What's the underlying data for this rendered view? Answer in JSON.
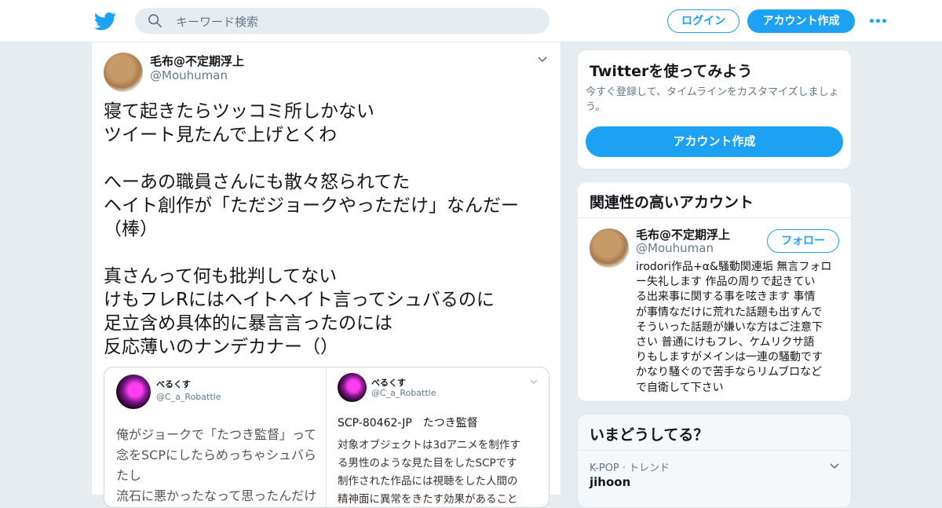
{
  "header": {
    "search_placeholder": "キーワード検索",
    "login_label": "ログイン",
    "signup_label": "アカウント作成"
  },
  "tweet": {
    "name": "毛布@不定期浮上",
    "handle": "@Mouhuman",
    "text": "寝て起きたらツッコミ所しかない\nツイート見たんで上げとくわ\n\nへーあの職員さんにも散々怒られてた\nヘイト創作が「ただジョークやっただけ」なんだー\n（棒）\n\n真さんって何も批判してない\nけもフレRにはヘイトヘイト言ってシュバるのに\n足立含め具体的に暴言言ったのには\n反応薄いのナンデカナー（）",
    "quote": {
      "left": {
        "name": "べるくす",
        "handle": "@C_a_Robattle",
        "text": "俺がジョークで「たつき監督」って\n念をSCPにしたらめっちゃシュバら\nたし\n流石に悪かったなって思ったんだけ"
      },
      "right": {
        "name": "べるくす",
        "handle": "@C_a_Robattle",
        "title": "SCP-80462-JP　たつき監督",
        "body": "対象オブジェクトは3dアニメを制作す\nる男性のような見た目をしたSCPです\n制作された作品には視聴をした人間の\n精神面に異常をきたす効果があること"
      }
    }
  },
  "signup_card": {
    "title": "Twitterを使ってみよう",
    "subtitle": "今すぐ登録して、タイムラインをカスタマイズしましょう。",
    "button_label": "アカウント作成"
  },
  "related_card": {
    "title": "関連性の高いアカウント",
    "name": "毛布@不定期浮上",
    "handle": "@Mouhuman",
    "follow_label": "フォロー",
    "bio": "irodori作品+α&騒動関連垢 無言フォロ\nー失礼します 作品の周りで起きてい\nる出来事に関する事を呟きます 事情\nが事情なだけに荒れた話題も出すんで\nそういった話題が嫌いな方はご注意下\nさい 普通にけもフレ、ケムリクサ語\nりもしますがメインは一連の騒動です\nかなり騒ぐので苦手ならリムブロなど\nで自衛して下さい"
  },
  "trends_card": {
    "title": "いまどうしてる？",
    "category": "K-POP · トレンド",
    "trend_name": "jihoon"
  },
  "colors": {
    "accent": "#1da1f2",
    "background": "#e6ecf0",
    "secondary_text": "#657786"
  }
}
